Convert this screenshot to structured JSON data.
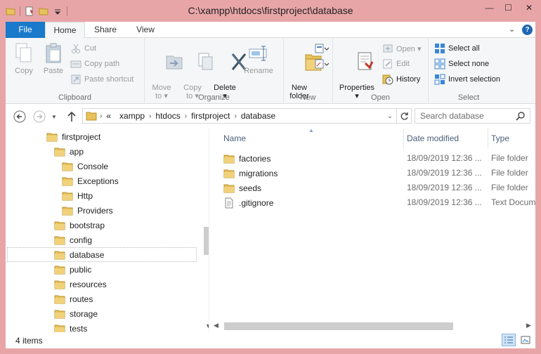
{
  "window": {
    "title": "C:\\xampp\\htdocs\\firstproject\\database",
    "controls": {
      "minimize": "—",
      "maximize": "☐",
      "close": "✕"
    }
  },
  "ribbon_tabs": {
    "file": "File",
    "home": "Home",
    "share": "Share",
    "view": "View",
    "help": "?"
  },
  "ribbon": {
    "clipboard": {
      "label": "Clipboard",
      "copy": "Copy",
      "paste": "Paste",
      "cut": "Cut",
      "copy_path": "Copy path",
      "paste_shortcut": "Paste shortcut"
    },
    "organize": {
      "label": "Organize",
      "move_to": "Move\nto ▾",
      "copy_to": "Copy\nto ▾",
      "delete": "Delete\n▾",
      "rename": "Rename"
    },
    "new": {
      "label": "New",
      "new_folder": "New\nfolder"
    },
    "open": {
      "label": "Open",
      "properties": "Properties\n▾",
      "open": "Open ▾",
      "edit": "Edit",
      "history": "History"
    },
    "select": {
      "label": "Select",
      "select_all": "Select all",
      "select_none": "Select none",
      "invert_selection": "Invert selection"
    }
  },
  "address": {
    "overflow": "«",
    "crumbs": [
      "xampp",
      "htdocs",
      "firstproject",
      "database"
    ],
    "search_placeholder": "Search database"
  },
  "nav_tree": [
    {
      "label": "firstproject",
      "level": 0
    },
    {
      "label": "app",
      "level": 1
    },
    {
      "label": "Console",
      "level": 2
    },
    {
      "label": "Exceptions",
      "level": 2
    },
    {
      "label": "Http",
      "level": 2
    },
    {
      "label": "Providers",
      "level": 2
    },
    {
      "label": "bootstrap",
      "level": 1
    },
    {
      "label": "config",
      "level": 1
    },
    {
      "label": "database",
      "level": 1,
      "selected": true
    },
    {
      "label": "public",
      "level": 1
    },
    {
      "label": "resources",
      "level": 1
    },
    {
      "label": "routes",
      "level": 1
    },
    {
      "label": "storage",
      "level": 1
    },
    {
      "label": "tests",
      "level": 1
    }
  ],
  "columns": {
    "name": "Name",
    "date": "Date modified",
    "type": "Type"
  },
  "files": [
    {
      "name": "factories",
      "date": "18/09/2019 12:36 ...",
      "type": "File folder",
      "icon": "folder"
    },
    {
      "name": "migrations",
      "date": "18/09/2019 12:36 ...",
      "type": "File folder",
      "icon": "folder"
    },
    {
      "name": "seeds",
      "date": "18/09/2019 12:36 ...",
      "type": "File folder",
      "icon": "folder"
    },
    {
      "name": ".gitignore",
      "date": "18/09/2019 12:36 ...",
      "type": "Text Docum",
      "icon": "text-file"
    }
  ],
  "status": {
    "items": "4 items"
  },
  "colors": {
    "title_bar": "#e8a5a8",
    "file_tab": "#1979ca",
    "folder": "#e8c25a"
  }
}
